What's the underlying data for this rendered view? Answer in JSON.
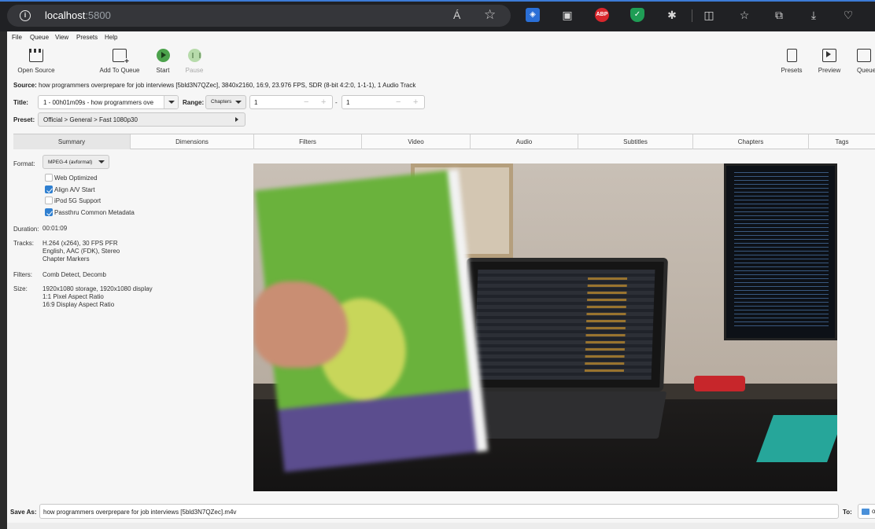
{
  "browser": {
    "url_host": "localhost",
    "url_port": ":5800",
    "read_aloud_glyph": "Á",
    "extensions": [
      "shield-icon",
      "gift-icon",
      "abp-icon",
      "green-shield-icon",
      "puzzle-icon",
      "split-screen-icon",
      "favorites-icon",
      "collections-icon",
      "download-icon",
      "health-icon"
    ],
    "abp_label": "ABP"
  },
  "menu": [
    "File",
    "Queue",
    "View",
    "Presets",
    "Help"
  ],
  "toolbar": {
    "open_source": "Open Source",
    "add_to_queue": "Add To Queue",
    "start": "Start",
    "pause": "Pause",
    "presets": "Presets",
    "preview": "Preview",
    "queue": "Queue"
  },
  "source": {
    "label": "Source:",
    "text": "how programmers overprepare for job interviews [5bld3N7QZec], 3840x2160, 16:9, 23.976 FPS, SDR (8-bit 4:2:0, 1-1-1), 1 Audio Track"
  },
  "title": {
    "label": "Title:",
    "value": "1 - 00h01m09s - how programmers ove",
    "range_label": "Range:",
    "range_mode": "Chapters",
    "range_start": "1",
    "range_sep": "-",
    "range_end": "1"
  },
  "preset": {
    "label": "Preset:",
    "value": "Official > General > Fast 1080p30"
  },
  "tabs": [
    "Summary",
    "Dimensions",
    "Filters",
    "Video",
    "Audio",
    "Subtitles",
    "Chapters",
    "Tags"
  ],
  "summary": {
    "format_label": "Format:",
    "format_value": "MPEG-4 (avformat)",
    "options": [
      {
        "label": "Web Optimized",
        "checked": false
      },
      {
        "label": "Align A/V Start",
        "checked": true
      },
      {
        "label": "iPod 5G Support",
        "checked": false
      },
      {
        "label": "Passthru Common Metadata",
        "checked": true
      }
    ],
    "duration_label": "Duration:",
    "duration_value": "00:01:09",
    "tracks_label": "Tracks:",
    "tracks": [
      "H.264 (x264), 30 FPS PFR",
      "English, AAC (FDK), Stereo",
      "Chapter Markers"
    ],
    "filters_label": "Filters:",
    "filters_value": "Comb Detect, Decomb",
    "size_label": "Size:",
    "size": [
      "1920x1080 storage, 1920x1080 display",
      "1:1 Pixel Aspect Ratio",
      "16:9 Display Aspect Ratio"
    ]
  },
  "save": {
    "label": "Save As:",
    "value": "how programmers overprepare for job interviews [5bld3N7QZec].m4v",
    "to_label": "To:",
    "to_value": "o"
  }
}
